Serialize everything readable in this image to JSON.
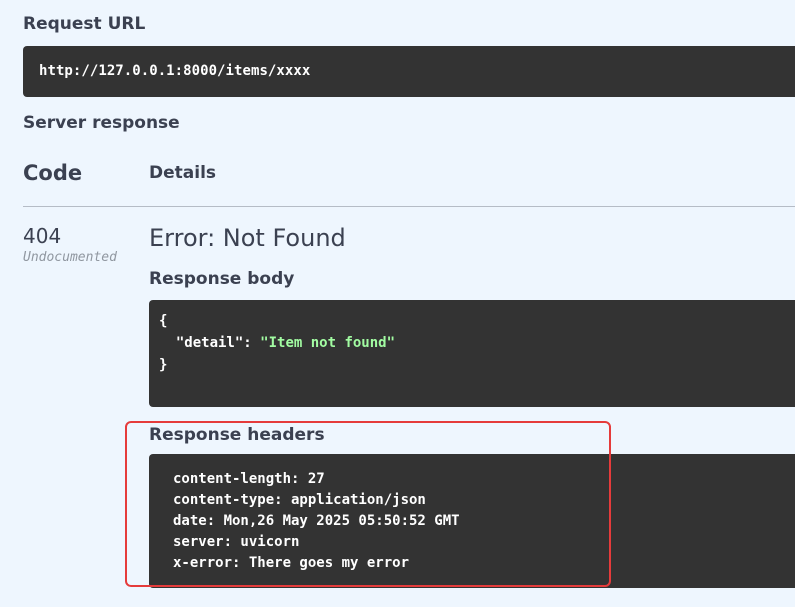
{
  "request_url": {
    "label": "Request URL",
    "value": "http://127.0.0.1:8000/items/xxxx"
  },
  "server_response": {
    "label": "Server response",
    "columns": {
      "code": "Code",
      "details": "Details"
    },
    "row": {
      "code": "404",
      "code_note": "Undocumented",
      "title": "Error: Not Found",
      "response_body": {
        "label": "Response body",
        "lines": {
          "open": "{",
          "key": "  \"detail\": ",
          "value": "\"Item not found\"",
          "close": "}"
        }
      },
      "response_headers": {
        "label": "Response headers",
        "lines": [
          "content-length: 27",
          "content-type: application/json",
          "date: Mon,26 May 2025 05:50:52 GMT",
          "server: uvicorn",
          "x-error: There goes my error"
        ]
      }
    }
  },
  "colors": {
    "page_background": "#eef6fe",
    "code_block_background": "#333333",
    "json_string": "#a2fca2",
    "highlight_border": "#e53b3b",
    "text": "#3b4151"
  }
}
